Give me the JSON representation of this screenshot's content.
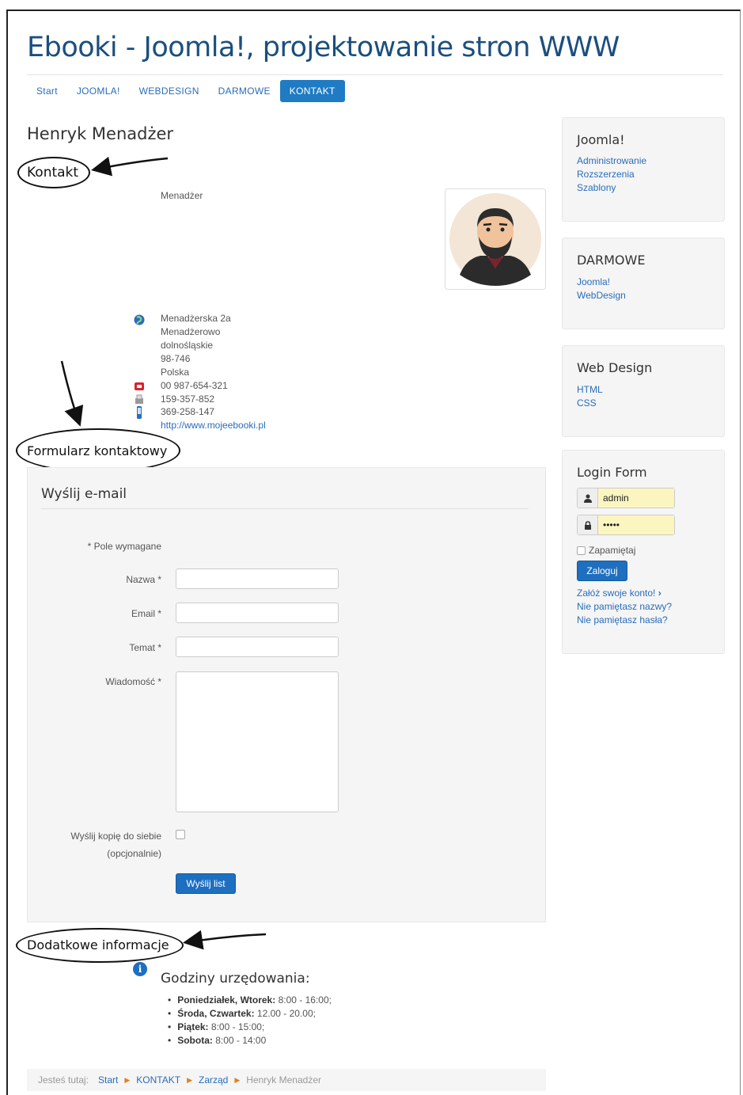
{
  "site": {
    "title": "Ebooki - Joomla!, projektowanie stron WWW"
  },
  "nav": [
    {
      "label": "Start"
    },
    {
      "label": "JOOMLA!"
    },
    {
      "label": "WEBDESIGN"
    },
    {
      "label": "DARMOWE"
    },
    {
      "label": "KONTAKT",
      "active": true
    }
  ],
  "contact": {
    "name": "Henryk Menadżer",
    "position": "Menadżer",
    "address": [
      "Menadżerska 2a",
      "Menadżerowo",
      "dolnośląskie",
      "98-746",
      "Polska"
    ],
    "phone": "00 987-654-321",
    "fax": "159-357-852",
    "mobile": "369-258-147",
    "website": "http://www.mojeebooki.pl"
  },
  "annotations": {
    "kontakt": "Kontakt",
    "form": "Formularz kontaktowy",
    "extra": "Dodatkowe informacje"
  },
  "form": {
    "title": "Wyślij e-mail",
    "required_note": "* Pole wymagane",
    "name_label": "Nazwa *",
    "email_label": "Email *",
    "subject_label": "Temat *",
    "message_label": "Wiadomość *",
    "copy_label_1": "Wyślij kopię do siebie",
    "copy_label_2": "(opcjonalnie)",
    "submit": "Wyślij list"
  },
  "hours": {
    "title": "Godziny urzędowania:",
    "items": [
      {
        "days": "Poniedziałek, Wtorek:",
        "time": "8:00 - 16:00;"
      },
      {
        "days": "Środa, Czwartek:",
        "time": "12.00 - 20.00;"
      },
      {
        "days": "Piątek:",
        "time": "8:00 - 15:00;"
      },
      {
        "days": "Sobota:",
        "time": "8:00 - 14:00"
      }
    ]
  },
  "breadcrumb": {
    "prefix": "Jesteś tutaj:",
    "items": [
      "Start",
      "KONTAKT",
      "Zarząd"
    ],
    "current": "Henryk Menadżer"
  },
  "sidebar": {
    "joomla": {
      "title": "Joomla!",
      "links": [
        "Administrowanie",
        "Rozszerzenia",
        "Szablony"
      ]
    },
    "darmowe": {
      "title": "DARMOWE",
      "links": [
        "Joomla!",
        "WebDesign"
      ]
    },
    "webdesign": {
      "title": "Web Design",
      "links": [
        "HTML",
        "CSS"
      ]
    },
    "login": {
      "title": "Login Form",
      "username": "admin",
      "password": "•••••",
      "remember": "Zapamiętaj",
      "submit": "Zaloguj",
      "register": "Załóż swoje konto!",
      "forgot_username": "Nie pamiętasz nazwy?",
      "forgot_password": "Nie pamiętasz hasła?"
    }
  }
}
